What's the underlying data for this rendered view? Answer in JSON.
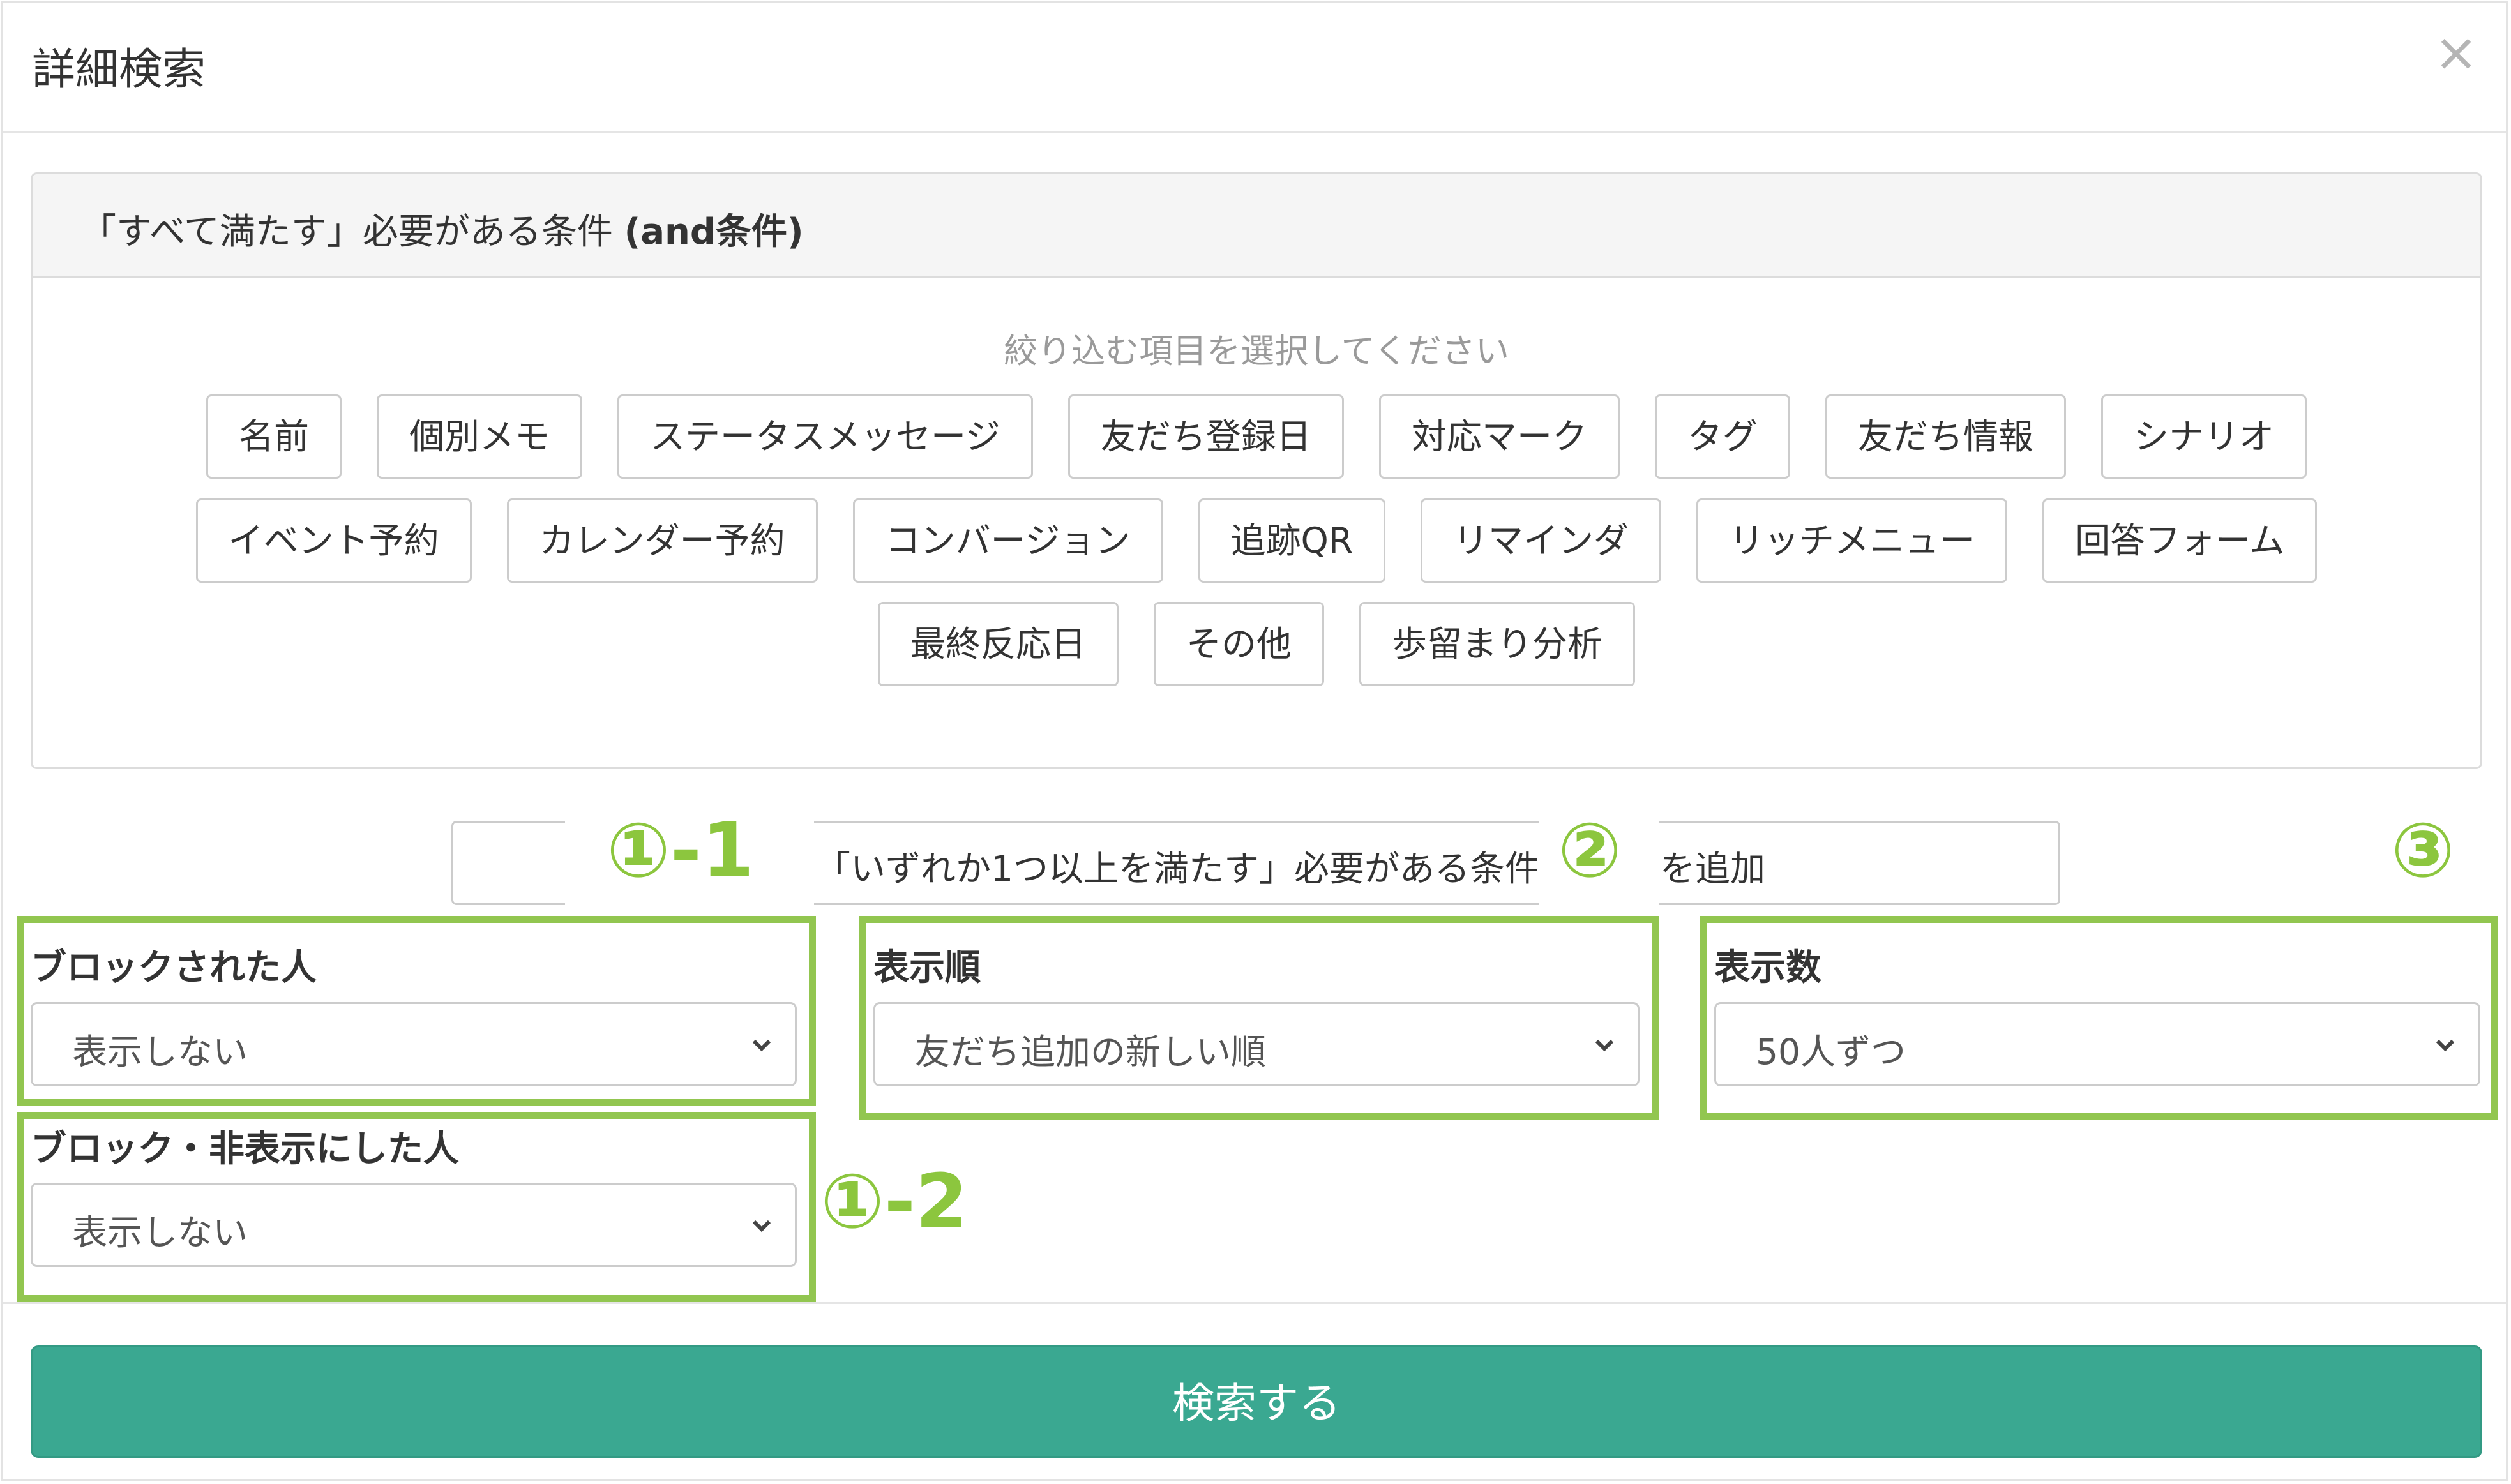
{
  "modal": {
    "title": "詳細検索",
    "close_symbol": "×"
  },
  "and_panel": {
    "heading_prefix": "「すべて満たす」必要がある条件 ",
    "heading_bold": "(and条件)",
    "hint": "絞り込む項目を選択してください",
    "rows": [
      [
        "名前",
        "個別メモ",
        "ステータスメッセージ",
        "友だち登録日",
        "対応マーク",
        "タグ",
        "友だち情報",
        "シナリオ"
      ],
      [
        "イベント予約",
        "カレンダー予約",
        "コンバージョン",
        "追跡QR",
        "リマインダ",
        "リッチメニュー",
        "回答フォーム"
      ],
      [
        "最終反応日",
        "その他",
        "歩留まり分析"
      ]
    ]
  },
  "or_bar": {
    "text_part1": "「いずれか1つ以上を満たす」必要がある条件(o",
    "text_part2": "を追加"
  },
  "annotations": {
    "a1_1": "①-1",
    "a1_2": "①-2",
    "a2": "②",
    "a3": "③",
    "color": "#8cc63e"
  },
  "fields": {
    "blocked": {
      "label": "ブロックされた人",
      "value": "表示しない"
    },
    "blocked_hidden": {
      "label": "ブロック・非表示にした人",
      "value": "表示しない"
    },
    "order": {
      "label": "表示順",
      "value": "友だち追加の新しい順"
    },
    "count": {
      "label": "表示数",
      "value": "50人ずつ"
    }
  },
  "footer": {
    "search_label": "検索する",
    "accent_color": "#3aa891"
  }
}
